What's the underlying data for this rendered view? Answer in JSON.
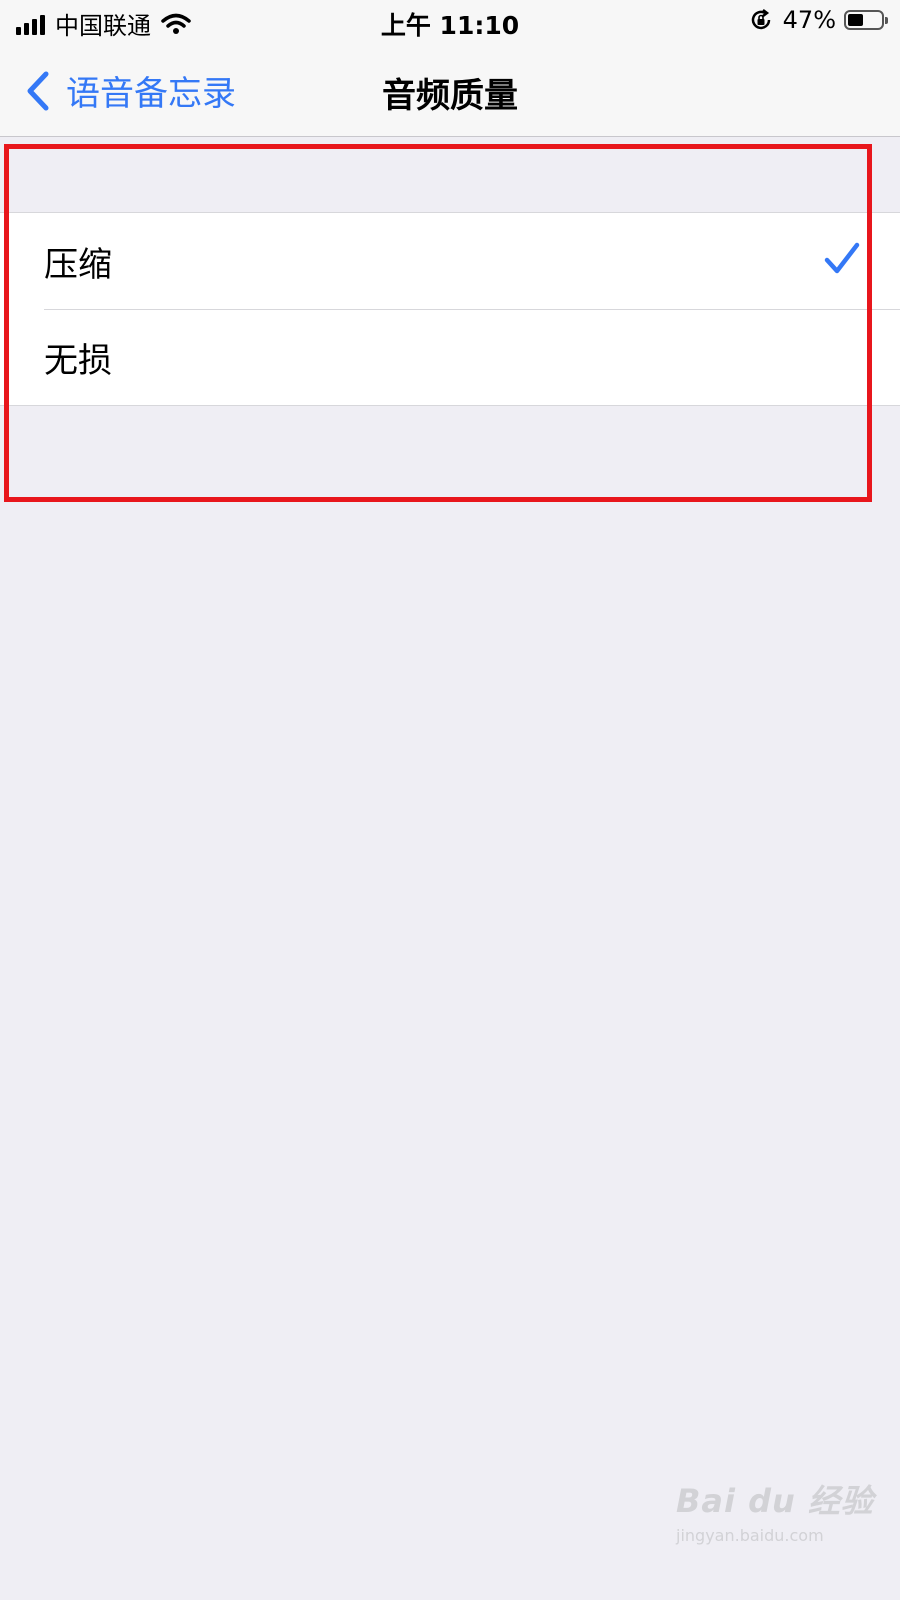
{
  "status_bar": {
    "carrier": "中国联通",
    "time": "上午 11:10",
    "battery_percent": "47%",
    "battery_level": 0.47,
    "icons": [
      "signal-icon",
      "wifi-icon",
      "rotation-lock-icon",
      "battery-icon"
    ]
  },
  "nav": {
    "back_label": "语音备忘录",
    "title": "音频质量"
  },
  "options": [
    {
      "label": "压缩",
      "selected": true
    },
    {
      "label": "无损",
      "selected": false
    }
  ],
  "colors": {
    "accent": "#3478f6",
    "highlight": "#e8161c",
    "background": "#efeef4"
  },
  "watermark": {
    "logo": "Bai du 经验",
    "url": "jingyan.baidu.com"
  }
}
